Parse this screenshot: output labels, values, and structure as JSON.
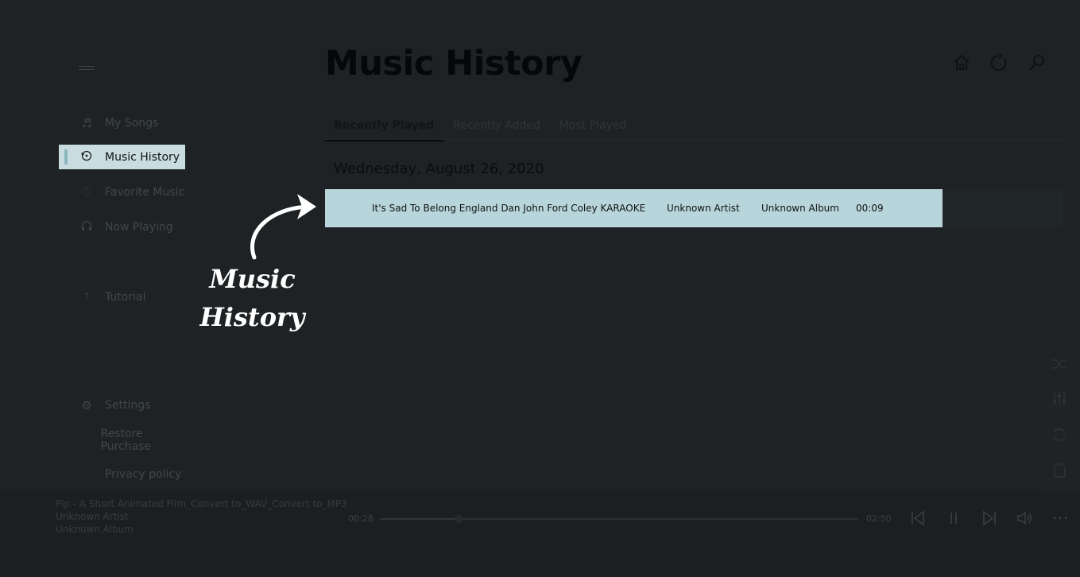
{
  "sidebar": {
    "items": [
      {
        "label": "My Songs",
        "icon": "music-note-icon",
        "glyph": "♬"
      },
      {
        "label": "Music History",
        "icon": "history-icon",
        "glyph": "⟲"
      },
      {
        "label": "Favorite Music",
        "icon": "heart-icon",
        "glyph": "♡"
      },
      {
        "label": "Now Playing",
        "icon": "headphones-icon",
        "glyph": "🎧"
      },
      {
        "label": "Tutorial",
        "icon": "question-icon",
        "glyph": "?"
      },
      {
        "label": "Settings",
        "icon": "gear-icon",
        "glyph": "⚙"
      },
      {
        "label": "Restore Purchase",
        "icon": "",
        "glyph": ""
      },
      {
        "label": "Privacy policy",
        "icon": "",
        "glyph": ""
      }
    ],
    "active_index": 1
  },
  "main": {
    "title": "Music History",
    "tabs": [
      {
        "label": "Recently Played"
      },
      {
        "label": "Recently Added"
      },
      {
        "label": "Most Played"
      }
    ],
    "active_tab": 0,
    "date_group": "Wednesday, August 26, 2020",
    "rows": [
      {
        "title": "It's Sad To Belong  England Dan  John Ford Coley KARAOKE",
        "artist": "Unknown Artist",
        "album": "Unknown Album",
        "duration": "00:09"
      }
    ]
  },
  "annotation": {
    "line1": "Music",
    "line2": "History"
  },
  "player": {
    "track": "Pip - A Short Animated Film_Convert to_WAV_Convert to_MP3",
    "artist": "Unknown Artist",
    "album": "Unknown Album",
    "elapsed": "00:28",
    "total": "02:50",
    "progress_fraction": 0.165
  },
  "colors": {
    "background": "#1e2224",
    "active_item": "#c9dde0",
    "selected_row": "#b7d5da",
    "accent_bar": "#8ab6bd"
  }
}
